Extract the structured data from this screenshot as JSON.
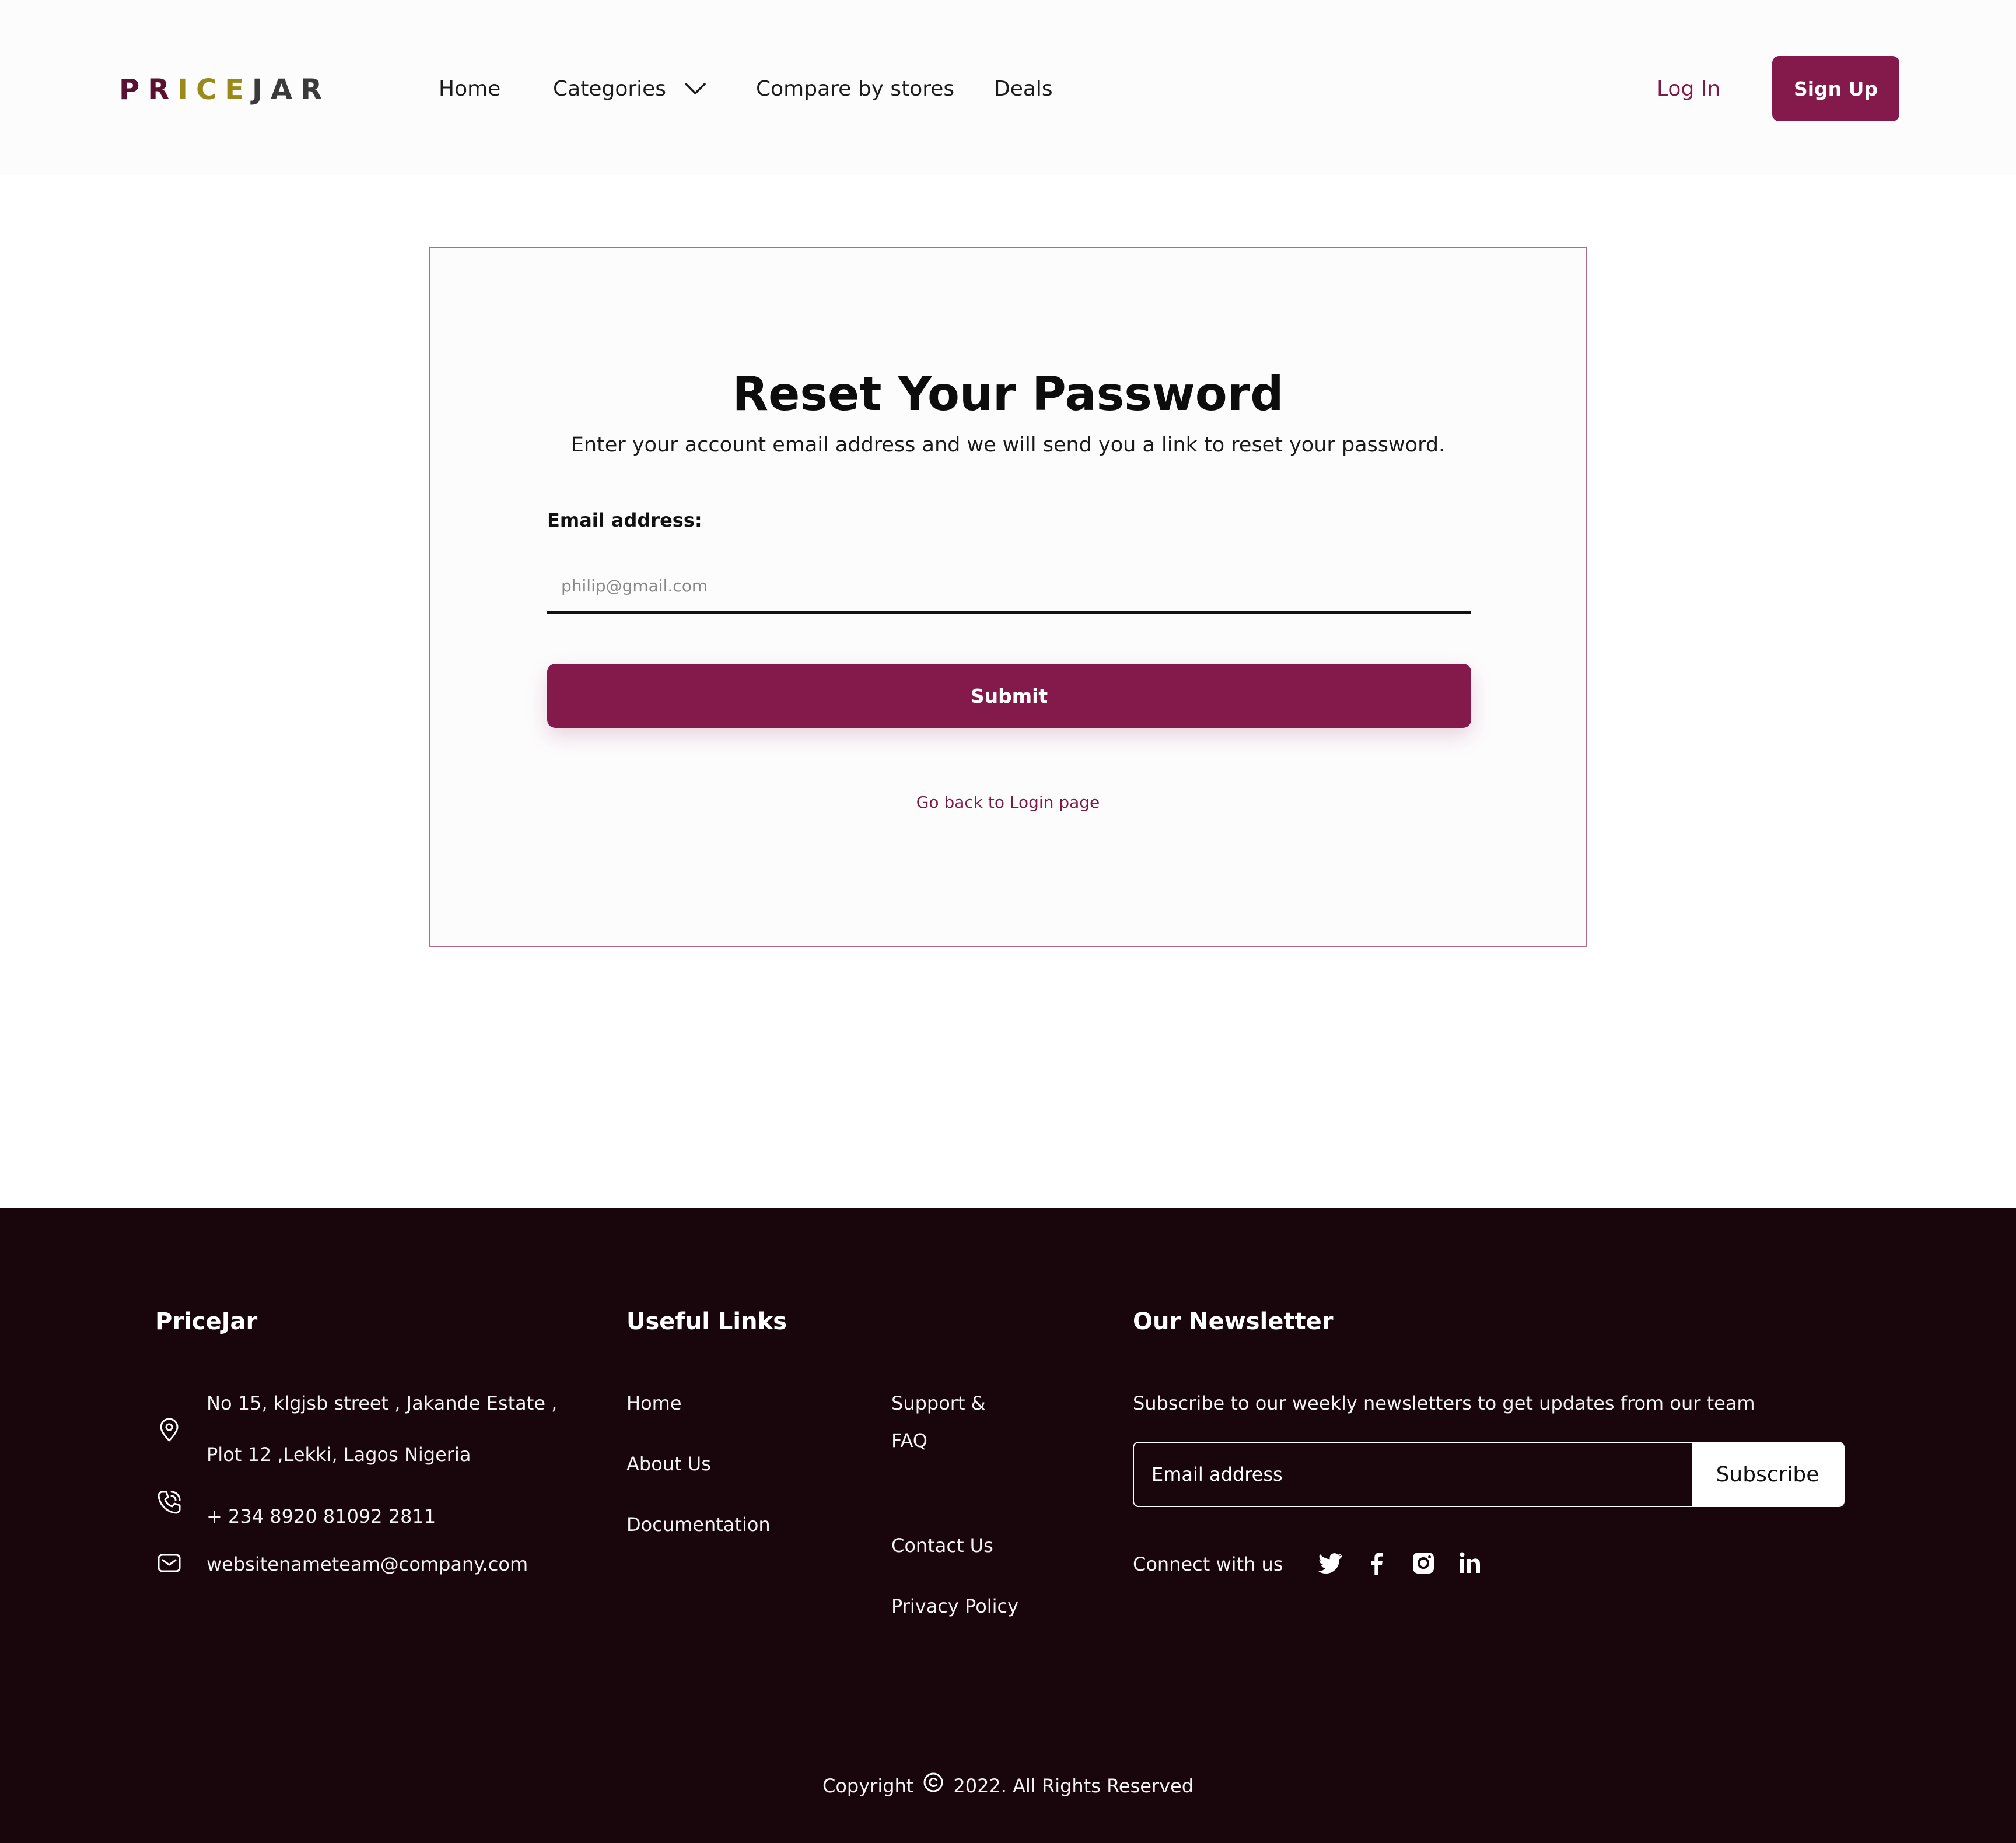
{
  "header": {
    "logo_letters": [
      {
        "char": "P",
        "color": "#5a1030"
      },
      {
        "char": "R",
        "color": "#5a1030"
      },
      {
        "char": "I",
        "color": "#9a8a1a"
      },
      {
        "char": "C",
        "color": "#9a8a1a"
      },
      {
        "char": "E",
        "color": "#9a8a1a"
      },
      {
        "char": "J",
        "color": "#3a3a3a"
      },
      {
        "char": "A",
        "color": "#3a3a3a"
      },
      {
        "char": "R",
        "color": "#3a3a3a"
      }
    ],
    "nav": {
      "home": "Home",
      "categories": "Categories",
      "compare": "Compare by stores",
      "deals": "Deals"
    },
    "login": "Log In",
    "signup": "Sign Up"
  },
  "reset": {
    "title": "Reset Your Password",
    "subtitle": "Enter your account email address and we will send you a link to reset your password.",
    "email_label": "Email address:",
    "email_placeholder": "philip@gmail.com",
    "submit": "Submit",
    "back_link": "Go back to Login page"
  },
  "footer": {
    "brand": "PriceJar",
    "address_line1": "No 15, klgjsb street , Jakande Estate ,",
    "address_line2": "Plot 12 ,Lekki, Lagos Nigeria",
    "phone": "+ 234 8920 81092 2811",
    "email": "websitenameteam@company.com",
    "useful_links_heading": "Useful Links",
    "links_col1": [
      "Home",
      "About Us",
      "Documentation"
    ],
    "links_col2": {
      "support_line1": "Support &",
      "support_line2": "FAQ",
      "contact": "Contact Us",
      "privacy": "Privacy Policy"
    },
    "newsletter_heading": "Our Newsletter",
    "newsletter_text": "Subscribe to our weekly newsletters to get updates from our team",
    "newsletter_placeholder": "Email address",
    "subscribe": "Subscribe",
    "connect": "Connect with us",
    "social_icons": [
      "twitter-icon",
      "facebook-icon",
      "instagram-icon",
      "linkedin-icon"
    ],
    "copyright_prefix": "Copyright",
    "copyright_text": "2022. All Rights Reserved"
  },
  "colors": {
    "brand": "#841a4c",
    "footer_bg": "#18060c",
    "card_border": "#b56a8a"
  }
}
